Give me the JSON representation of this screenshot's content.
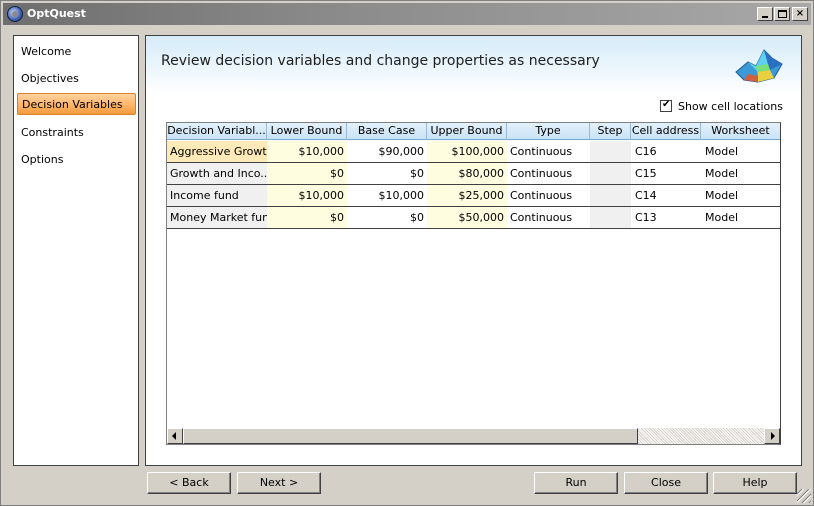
{
  "window": {
    "title": "OptQuest",
    "min_label": "_",
    "max_label": "□",
    "close_label": "×"
  },
  "nav": {
    "items": [
      {
        "label": "Welcome"
      },
      {
        "label": "Objectives"
      },
      {
        "label": "Decision Variables",
        "active": true
      },
      {
        "label": "Constraints"
      },
      {
        "label": "Options"
      }
    ]
  },
  "main": {
    "heading": "Review decision variables and change properties as necessary",
    "show_cell_locations": {
      "label": "Show cell locations",
      "checked": true
    }
  },
  "grid": {
    "columns": [
      "Decision Variabl...",
      "Lower Bound",
      "Base Case",
      "Upper Bound",
      "Type",
      "Step",
      "Cell address",
      "Worksheet"
    ],
    "rows": [
      {
        "name": "Aggressive Growt...",
        "lower": "$10,000",
        "base": "$90,000",
        "upper": "$100,000",
        "type": "Continuous",
        "step": "",
        "address": "C16",
        "worksheet": "Model"
      },
      {
        "name": "Growth and Inco...",
        "lower": "$0",
        "base": "$0",
        "upper": "$80,000",
        "type": "Continuous",
        "step": "",
        "address": "C15",
        "worksheet": "Model"
      },
      {
        "name": "Income fund",
        "lower": "$10,000",
        "base": "$10,000",
        "upper": "$25,000",
        "type": "Continuous",
        "step": "",
        "address": "C14",
        "worksheet": "Model"
      },
      {
        "name": "Money Market fund",
        "lower": "$0",
        "base": "$0",
        "upper": "$50,000",
        "type": "Continuous",
        "step": "",
        "address": "C13",
        "worksheet": "Model"
      }
    ]
  },
  "buttons": {
    "back": "< Back",
    "next": "Next >",
    "run": "Run",
    "close": "Close",
    "help": "Help"
  },
  "colors": {
    "active_nav": "#f29a3c",
    "header_band": "#d6ebf8",
    "selected_row": "#fdeab8",
    "bound_cells": "#fffde0"
  },
  "icons": {
    "app": "optquest-logo-icon",
    "header": "surface-plot-icon"
  }
}
